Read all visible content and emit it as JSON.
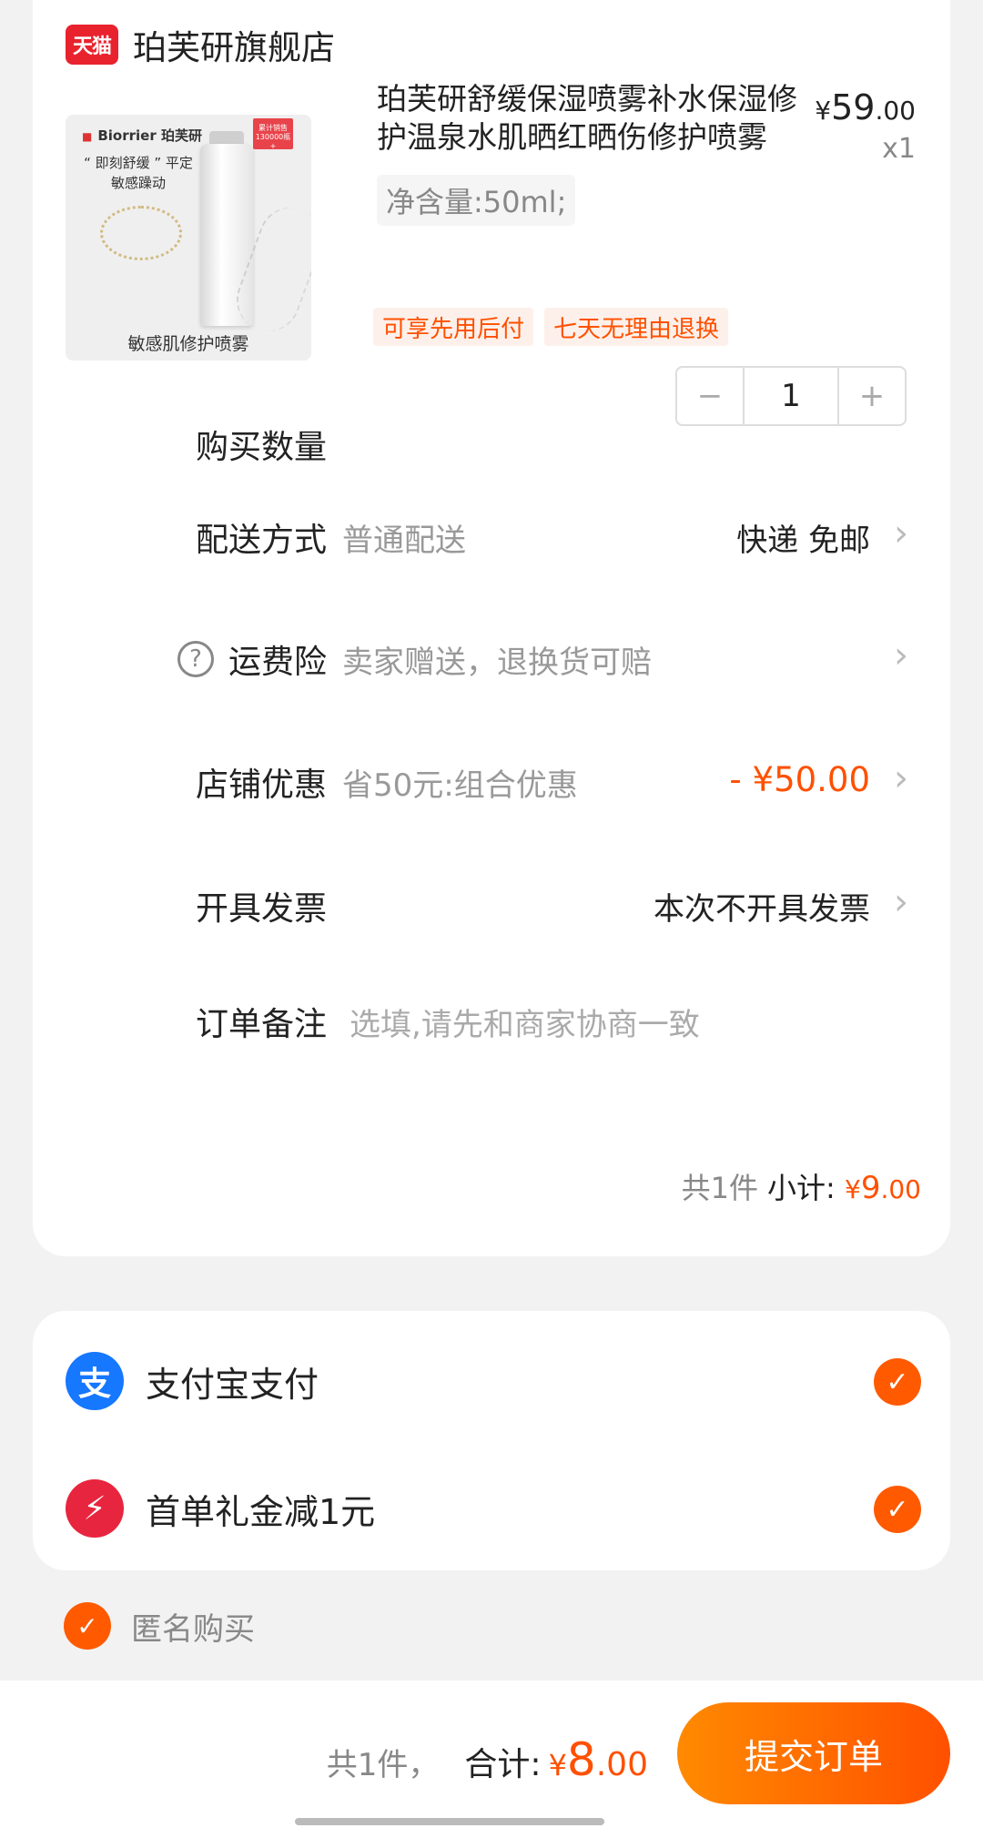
{
  "store": {
    "logo_text": "天猫",
    "name": "珀芙研旗舰店"
  },
  "product": {
    "image": {
      "brand": "Biorrier 珀芙研",
      "badge": "累计销售 130000瓶+",
      "slogan": "“ 即刻舒缓 ” 平定敏感躁动",
      "caption": "敏感肌修护喷雾"
    },
    "title": "珀芙研舒缓保湿喷雾补水保湿修护温泉水肌晒红晒伤修护喷雾",
    "price_yen": "¥",
    "price_int": "59",
    "price_dec": ".00",
    "quantity_text": "x1",
    "spec": "净含量:50ml;",
    "tags": [
      "可享先用后付",
      "七天无理由退换"
    ]
  },
  "rows": {
    "quantity": {
      "label": "购买数量",
      "value": "1",
      "minus": "−",
      "plus": "+"
    },
    "delivery": {
      "label": "配送方式",
      "sub": "普通配送",
      "value": "快递 免邮"
    },
    "insurance": {
      "label": "运费险",
      "sub": "卖家赠送，退换货可赔"
    },
    "discount": {
      "label": "店铺优惠",
      "sub": "省50元:组合优惠",
      "value": "- ¥50.00"
    },
    "invoice": {
      "label": "开具发票",
      "value": "本次不开具发票"
    },
    "note": {
      "label": "订单备注",
      "placeholder": "选填,请先和商家协商一致"
    }
  },
  "subtotal": {
    "count": "共1件",
    "label": "小计:",
    "yen": "¥",
    "int": "9",
    "dec": ".00"
  },
  "payment": {
    "alipay": {
      "icon_text": "支",
      "label": "支付宝支付"
    },
    "coupon": {
      "icon_text": "⚡",
      "label": "首单礼金减1元"
    }
  },
  "anonymous": {
    "label": "匿名购买"
  },
  "footer": {
    "count": "共1件，",
    "label": "合计:",
    "yen": "¥",
    "int": "8",
    "dec": ".00",
    "submit": "提交订单"
  },
  "colors": {
    "accent": "#ff5000",
    "alipay": "#1677ff",
    "tmall": "#e8232e"
  }
}
